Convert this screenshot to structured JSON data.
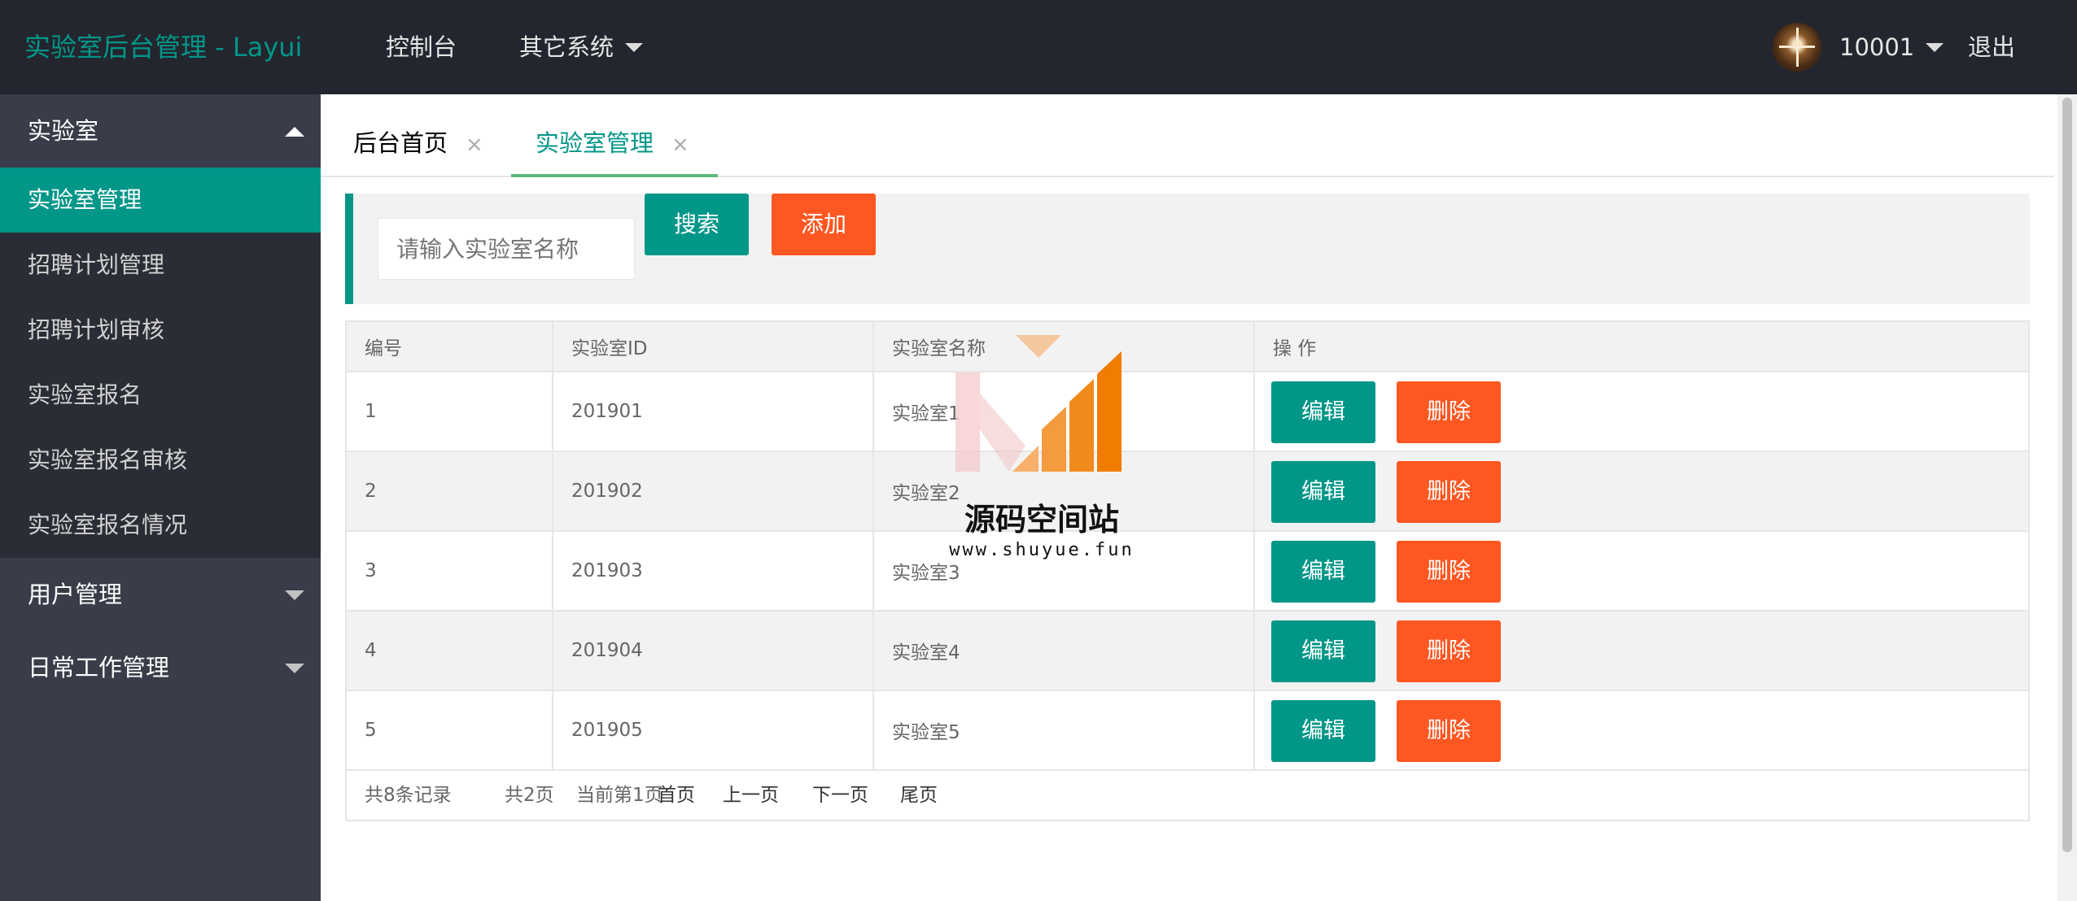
{
  "header": {
    "logo": "实验室后台管理 - Layui",
    "nav": [
      "控制台",
      "其它系统"
    ],
    "user": "10001",
    "logout": "退出"
  },
  "sidebar": {
    "groups": [
      {
        "label": "实验室",
        "expanded": true
      },
      {
        "label": "用户管理",
        "expanded": false
      },
      {
        "label": "日常工作管理",
        "expanded": false
      }
    ],
    "items": [
      "实验室管理",
      "招聘计划管理",
      "招聘计划审核",
      "实验室报名",
      "实验室报名审核",
      "实验室报名情况"
    ],
    "active_item": "实验室管理"
  },
  "tabs": [
    {
      "label": "后台首页",
      "close": "×"
    },
    {
      "label": "实验室管理",
      "close": "×"
    }
  ],
  "toolbar": {
    "search_placeholder": "请输入实验室名称",
    "search_button": "搜索",
    "add_button": "添加"
  },
  "table": {
    "headers": [
      "编号",
      "实验室ID",
      "实验室名称",
      "操 作"
    ],
    "rows": [
      {
        "no": "1",
        "id": "201901",
        "name": "实验室1"
      },
      {
        "no": "2",
        "id": "201902",
        "name": "实验室2"
      },
      {
        "no": "3",
        "id": "201903",
        "name": "实验室3"
      },
      {
        "no": "4",
        "id": "201904",
        "name": "实验室4"
      },
      {
        "no": "5",
        "id": "201905",
        "name": "实验室5"
      }
    ],
    "edit_label": "编辑",
    "delete_label": "删除"
  },
  "pager": {
    "total_records": "共8条记录",
    "total_pages": "共2页",
    "current_page": "当前第1页",
    "first": "首页",
    "prev": "上一页",
    "next": "下一页",
    "last": "尾页"
  },
  "watermark": {
    "title": "源码空间站",
    "url": "www.shuyue.fun"
  },
  "colors": {
    "primary": "#009688",
    "danger": "#ff5722",
    "header_bg": "#23262e",
    "sidebar_bg": "#393d49",
    "tab_underline": "#5fb878"
  }
}
